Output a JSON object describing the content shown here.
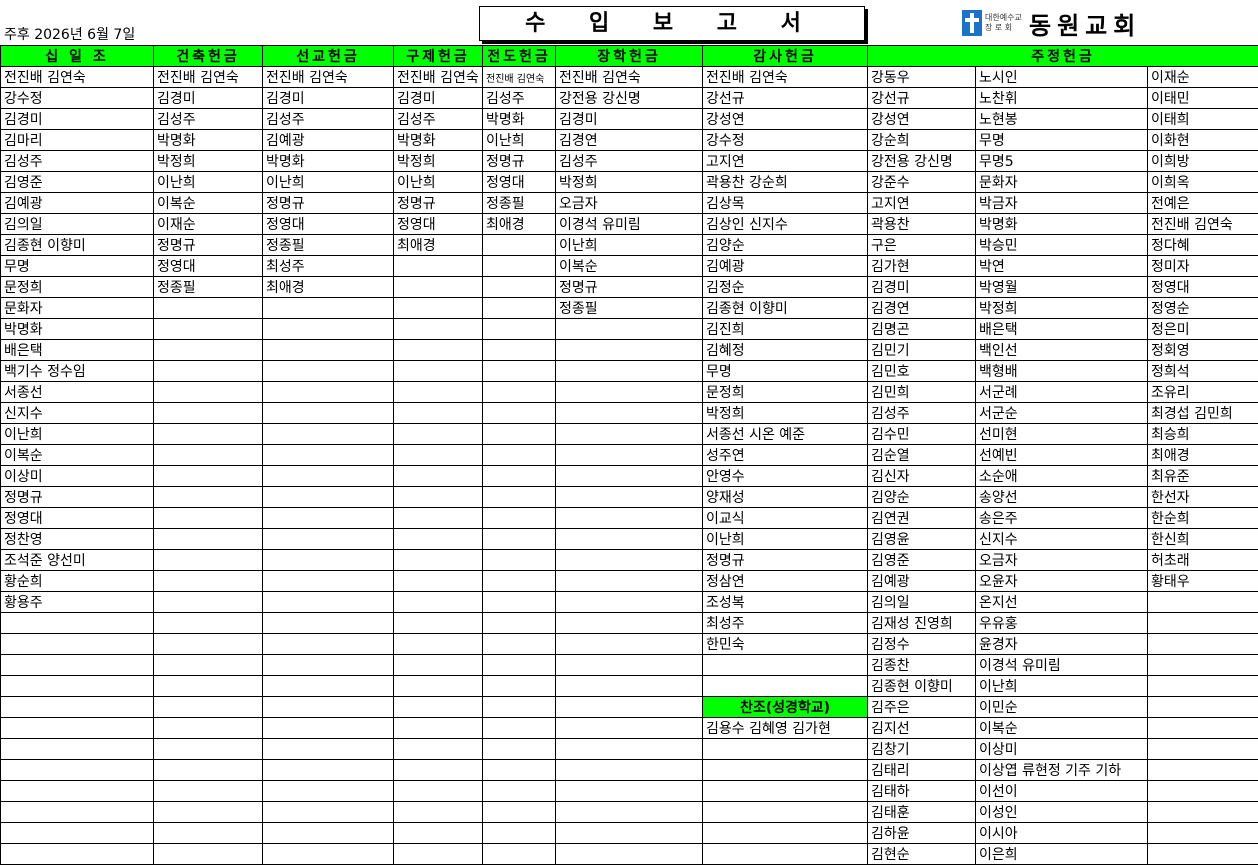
{
  "header": {
    "date": "주후 2026년 6월 7일",
    "title": "수 입 보 고 서",
    "logo_sub": "대한예수교 장 로 회",
    "logo_name": "동원교회"
  },
  "columns": [
    "십 일 조",
    "건축헌금",
    "선교헌금",
    "구제헌금",
    "전도헌금",
    "장학헌금",
    "감사헌금",
    "주정헌금"
  ],
  "col_a": [
    "전진배 김연숙",
    "강수정",
    "김경미",
    "김마리",
    "김성주",
    "김영준",
    "김예광",
    "김의일",
    "김종현 이향미",
    "무명",
    "문정희",
    "문화자",
    "박명화",
    "배은택",
    "백기수 정수임",
    "서종선",
    "신지수",
    "이난희",
    "이복순",
    "이상미",
    "정명규",
    "정영대",
    "정찬영",
    "조석준 양선미",
    "황순희",
    "황용주"
  ],
  "col_b": [
    "전진배 김연숙",
    "김경미",
    "김성주",
    "박명화",
    "박정희",
    "이난희",
    "이복순",
    "이재순",
    "정명규",
    "정영대",
    "정종필"
  ],
  "col_c": [
    "전진배 김연숙",
    "김경미",
    "김성주",
    "김예광",
    "박명화",
    "이난희",
    "정명규",
    "정영대",
    "정종필",
    "최성주",
    "최애경"
  ],
  "col_d": [
    "전진배 김연숙",
    "김경미",
    "김성주",
    "박명화",
    "박정희",
    "이난희",
    "정명규",
    "정영대",
    "최애경"
  ],
  "col_e": [
    "전진배 김연숙",
    "김성주",
    "박명화",
    "이난희",
    "정명규",
    "정영대",
    "정종필",
    "최애경"
  ],
  "col_f": [
    "전진배 김연숙",
    "강전용 강신명",
    "김경미",
    "김경연",
    "김성주",
    "박정희",
    "오금자",
    "이경석 유미림",
    "이난희",
    "이복순",
    "정명규",
    "정종필"
  ],
  "col_g": [
    "전진배 김연숙",
    "강선규",
    "강성연",
    "강수정",
    "고지연",
    "곽용찬 강순희",
    "김상목",
    "김상인 신지수",
    "김양순",
    "김예광",
    "김정순",
    "김종현 이향미",
    "김진희",
    "김혜정",
    "무명",
    "문정희",
    "박정희",
    "서종선 시온 예준",
    "성주연",
    "안영수",
    "양재성",
    "이교식",
    "이난희",
    "정명규",
    "정삼연",
    "조성복",
    "최성주",
    "한민숙"
  ],
  "special": {
    "label": "찬조(성경학교)",
    "names": "김용수 김혜영 김가현"
  },
  "col_h1": [
    "강동우",
    "강선규",
    "강성연",
    "강순희",
    "강전용 강신명",
    "강준수",
    "고지연",
    "곽용찬",
    "구은",
    "김가현",
    "김경미",
    "김경연",
    "김명곤",
    "김민기",
    "김민호",
    "김민희",
    "김성주",
    "김수민",
    "김순열",
    "김신자",
    "김양순",
    "김연권",
    "김영윤",
    "김영준",
    "김예광",
    "김의일",
    "김재성 진영희",
    "김정수",
    "김종찬",
    "김종현 이향미",
    "김주은",
    "김지선",
    "김창기",
    "김태리",
    "김태하",
    "김태훈",
    "김하윤",
    "김현순"
  ],
  "col_h2": [
    "노시인",
    "노찬휘",
    "노현봉",
    "무명",
    "무명5",
    "문화자",
    "박금자",
    "박명화",
    "박승민",
    "박연",
    "박영월",
    "박정희",
    "배은택",
    "백인선",
    "백형배",
    "서군례",
    "서군순",
    "선미현",
    "선예빈",
    "소순애",
    "송양선",
    "송은주",
    "신지수",
    "오금자",
    "오윤자",
    "온지선",
    "우유홍",
    "윤경자",
    "이경석 유미림",
    "이난희",
    "이민순",
    "이복순",
    "이상미",
    "이상엽 류현정 기주 기하",
    "이선이",
    "이성인",
    "이시아",
    "이은희"
  ],
  "col_h3": [
    "이재순",
    "이태민",
    "이태희",
    "이화현",
    "이희방",
    "이희옥",
    "전예은",
    "전진배 김연숙",
    "정다혜",
    "정미자",
    "정영대",
    "정영순",
    "정은미",
    "정회영",
    "정희석",
    "조유리",
    "최경섭 김민희",
    "최승희",
    "최애경",
    "최유준",
    "한선자",
    "한순희",
    "한신희",
    "허초래",
    "황태우"
  ]
}
